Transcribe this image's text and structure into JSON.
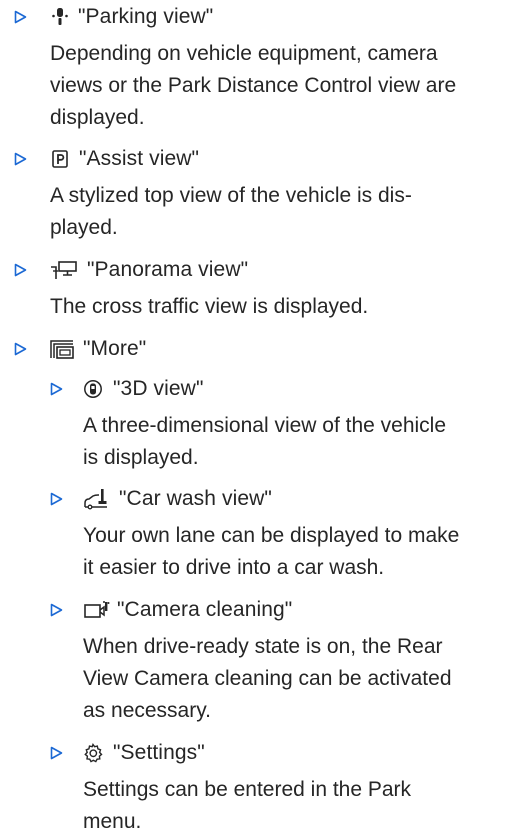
{
  "items": [
    {
      "label": "\"Parking view\"",
      "icon": "parking-view-icon",
      "description": [
        "Depending on vehicle equipment, camera",
        "views or the Park Distance Control view are",
        "displayed."
      ]
    },
    {
      "label": "\"Assist view\"",
      "icon": "assist-view-icon",
      "description": [
        "A stylized top view of the vehicle is dis-",
        "played."
      ]
    },
    {
      "label": "\"Panorama view\"",
      "icon": "panorama-view-icon",
      "description": [
        "The cross traffic view is displayed."
      ]
    },
    {
      "label": "\"More\"",
      "icon": "more-icon",
      "subitems": [
        {
          "label": "\"3D view\"",
          "icon": "3d-view-icon",
          "description": [
            "A three-dimensional view of the vehicle",
            "is displayed."
          ]
        },
        {
          "label": "\"Car wash view\"",
          "icon": "car-wash-view-icon",
          "description": [
            "Your own lane can be displayed to make",
            "it easier to drive into a car wash."
          ]
        },
        {
          "label": "\"Camera cleaning\"",
          "icon": "camera-cleaning-icon",
          "description": [
            "When drive-ready state is on, the Rear",
            "View Camera cleaning can be activated",
            "as necessary."
          ]
        },
        {
          "label": "\"Settings\"",
          "icon": "settings-icon",
          "description": [
            "Settings can be entered in the Park",
            "menu."
          ]
        }
      ]
    }
  ],
  "colors": {
    "text": "#262626",
    "arrow": "#1c69d4"
  }
}
